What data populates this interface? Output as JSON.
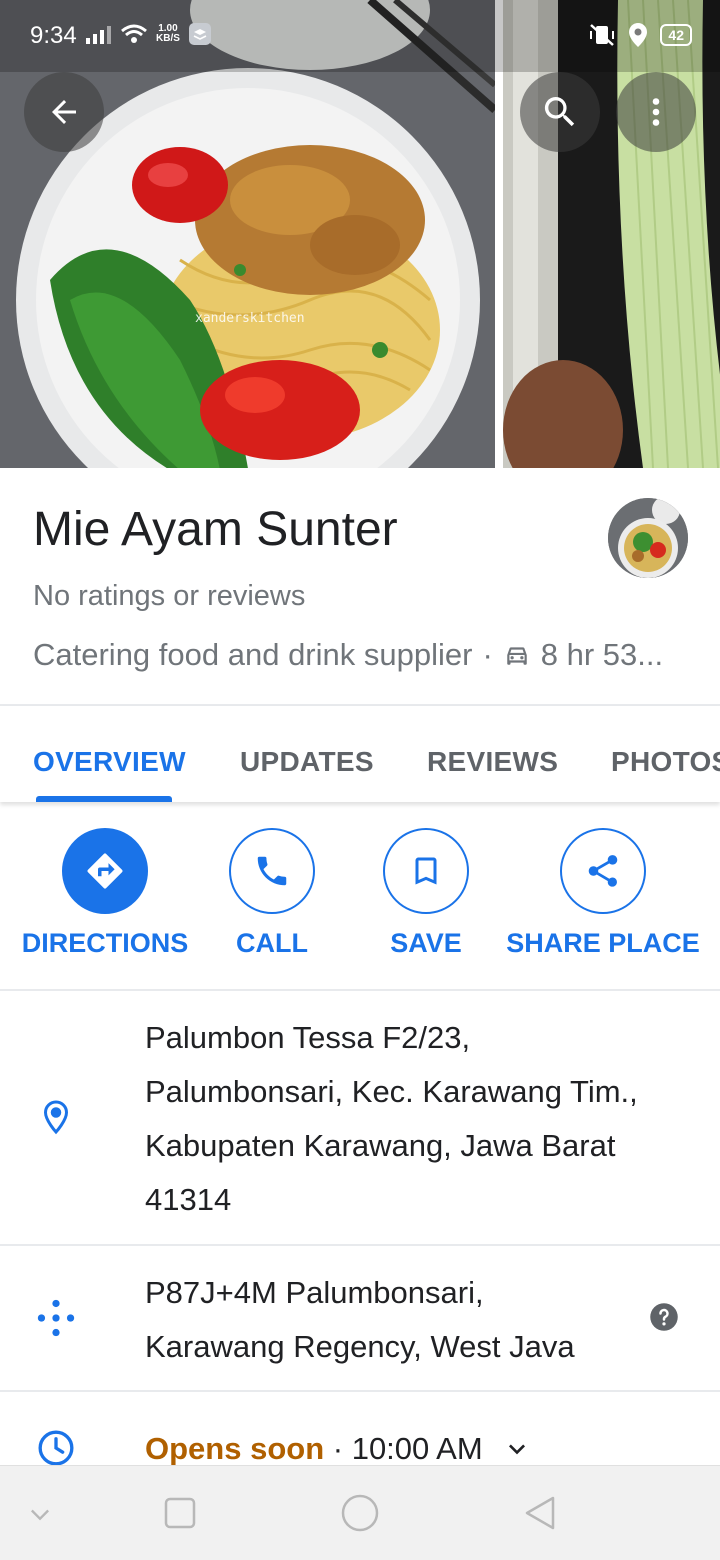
{
  "status_bar": {
    "time": "9:34",
    "speed_value": "1.00",
    "speed_unit": "KB/S",
    "battery": "42"
  },
  "place": {
    "name": "Mie Ayam Sunter",
    "ratings": "No ratings or reviews",
    "category": "Catering food and drink supplier",
    "separator": "·",
    "drive_time": "8 hr 53..."
  },
  "photo": {
    "watermark": "xanderskitchen"
  },
  "tabs": [
    {
      "label": "OVERVIEW",
      "active": true
    },
    {
      "label": "UPDATES",
      "active": false
    },
    {
      "label": "REVIEWS",
      "active": false
    },
    {
      "label": "PHOTOS",
      "active": false
    }
  ],
  "actions": {
    "directions": "DIRECTIONS",
    "call": "CALL",
    "save": "SAVE",
    "share": "SHARE PLACE"
  },
  "details": {
    "address_lines": [
      "Palumbon Tessa F2/23,",
      "Palumbonsari, Kec. Karawang Tim.,",
      "Kabupaten Karawang, Jawa Barat",
      "41314"
    ],
    "plus_code_lines": [
      "P87J+4M Palumbonsari,",
      "Karawang Regency, West Java"
    ],
    "hours_status": "Opens soon",
    "hours_separator": " · ",
    "hours_time": "10:00 AM"
  },
  "colors": {
    "accent": "#1a73e8",
    "opens_soon": "#b06000",
    "secondary_text": "#70757a"
  },
  "icons": [
    "back-arrow-icon",
    "search-icon",
    "more-vert-icon",
    "car-icon",
    "directions-icon",
    "phone-icon",
    "bookmark-icon",
    "share-icon",
    "location-pin-icon",
    "plus-code-icon",
    "help-icon",
    "clock-icon",
    "chevron-down-icon"
  ]
}
